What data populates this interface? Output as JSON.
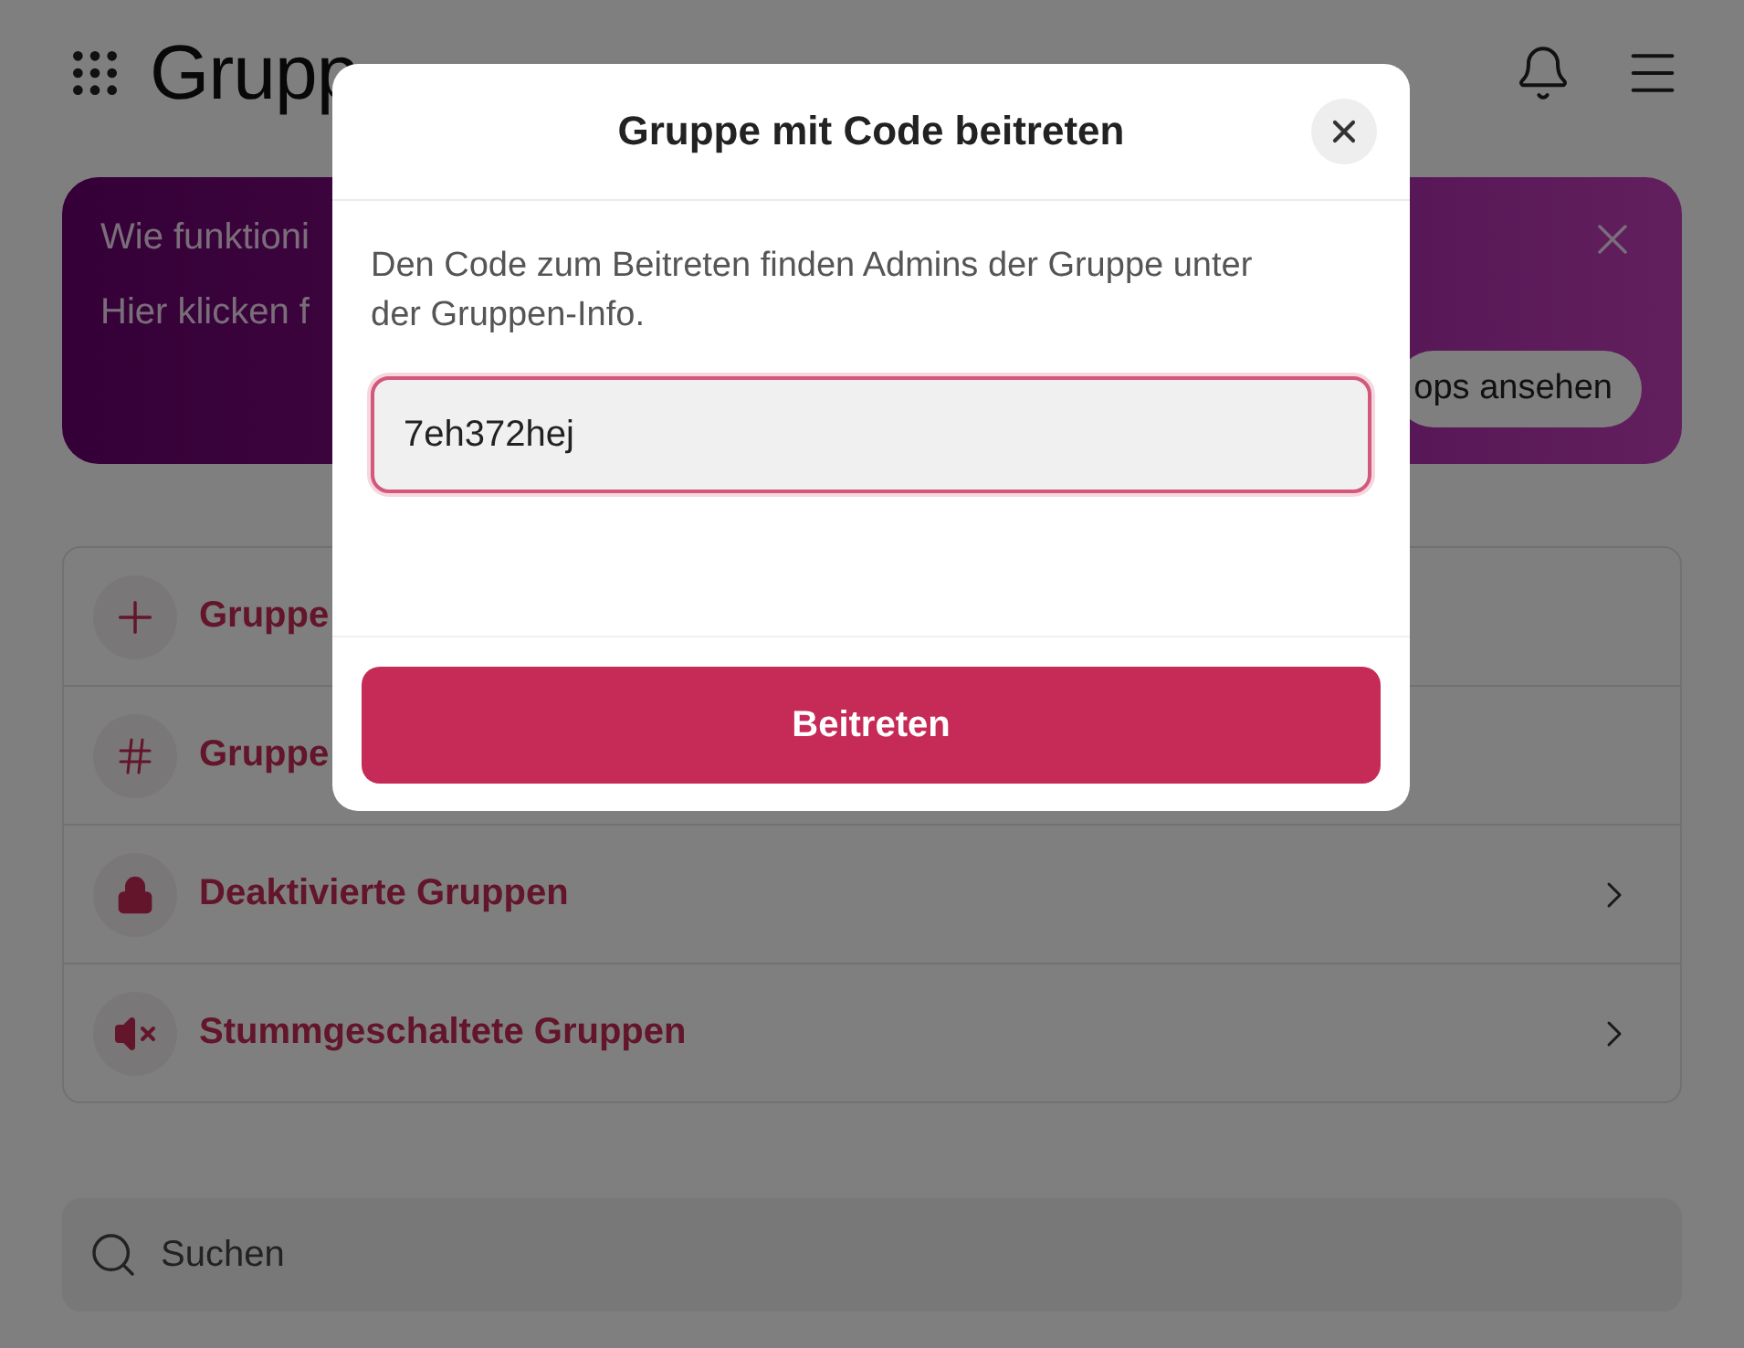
{
  "header": {
    "title": "Grupp"
  },
  "banner": {
    "title": "Wie funktioni",
    "text": "Hier klicken f",
    "button": "ops ansehen"
  },
  "menu": [
    {
      "kind": "plus",
      "label": "Gruppe",
      "has_arrow": false
    },
    {
      "kind": "hash",
      "label": "Gruppe",
      "has_arrow": false
    },
    {
      "kind": "lock",
      "label": "Deaktivierte Gruppen",
      "has_arrow": true
    },
    {
      "kind": "mute",
      "label": "Stummgeschaltete Gruppen",
      "has_arrow": true
    }
  ],
  "search": {
    "placeholder": "Suchen"
  },
  "dialog": {
    "title": "Gruppe mit Code beitreten",
    "description": "Den Code zum Beitreten finden Admins der Gruppe unter der Gruppen-Info.",
    "code": "7eh372hej",
    "submit": "Beitreten"
  }
}
